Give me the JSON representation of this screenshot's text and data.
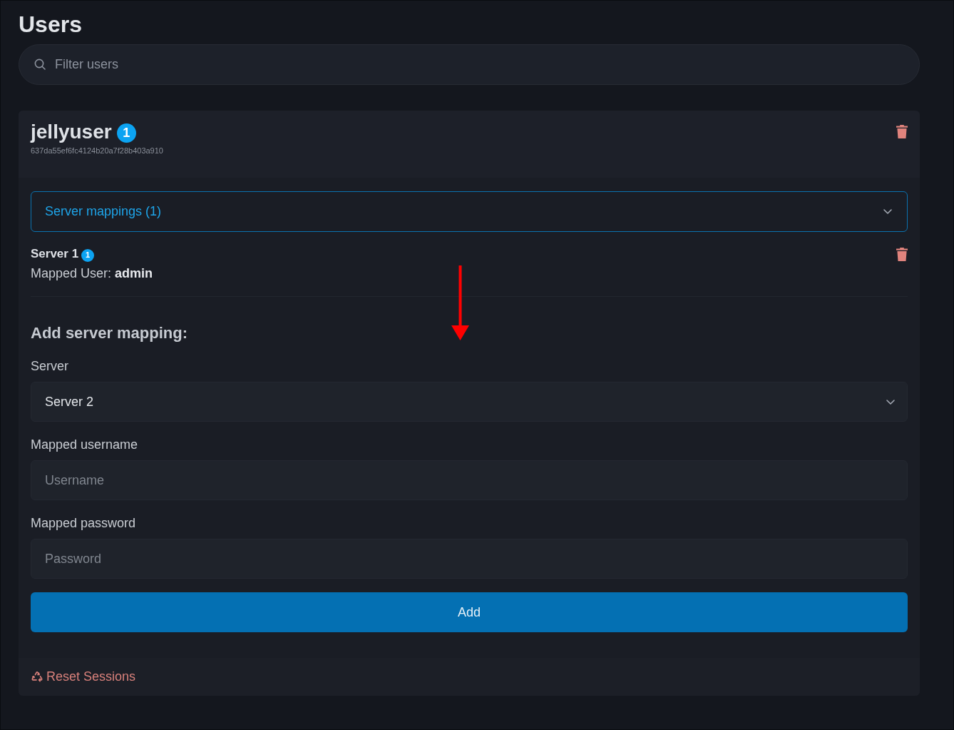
{
  "page": {
    "title": "Users"
  },
  "search": {
    "placeholder": "Filter users"
  },
  "users": [
    {
      "name": "jellyuser",
      "badge": "1",
      "id": "637da55ef6fc4124b20a7f28b403a910",
      "mappings_panel": {
        "label": "Server mappings (1)",
        "expanded": true
      },
      "mappings": [
        {
          "server": "Server 1",
          "badge": "1",
          "mapped_user": "Mapped User: **admin**"
        }
      ],
      "add_form": {
        "title": "Add server mapping:",
        "fields": [
          {
            "kind": "select",
            "label": "Server",
            "value": "Server 2"
          },
          {
            "kind": "text",
            "label": "Mapped username",
            "placeholder": "Username"
          },
          {
            "kind": "password",
            "label": "Mapped password",
            "placeholder": "Password"
          }
        ],
        "submit": "Add"
      },
      "reset_sessions": "Reset Sessions"
    }
  ]
}
